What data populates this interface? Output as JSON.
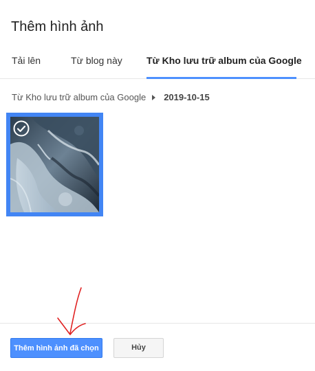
{
  "dialog": {
    "title": "Thêm hình ảnh"
  },
  "tabs": [
    {
      "label": "Tải lên",
      "active": false
    },
    {
      "label": "Từ blog này",
      "active": false
    },
    {
      "label": "Từ Kho lưu trữ album của Google",
      "active": true
    }
  ],
  "breadcrumb": {
    "root": "Từ Kho lưu trữ album của Google",
    "current": "2019-10-15"
  },
  "photos": [
    {
      "selected": true,
      "icon": "check-circle-icon"
    }
  ],
  "footer": {
    "add_label": "Thêm hình ảnh đã chọn",
    "cancel_label": "Hủy"
  },
  "colors": {
    "accent": "#4d90fe",
    "selection": "#4285f4",
    "annotation": "#e02020"
  }
}
